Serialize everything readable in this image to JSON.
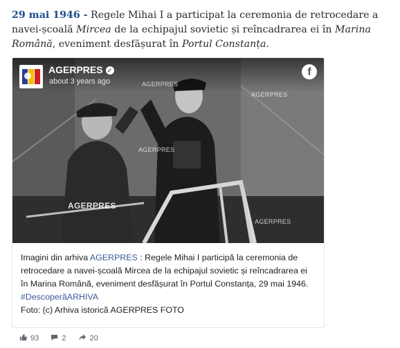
{
  "intro": {
    "date": "29 mai 1946 -",
    "part1": "Regele Mihai I a participat la ceremonia de retrocedare a navei-școală",
    "ship": "Mircea",
    "part2": "de la echipajul sovietic și reîncadrarea ei în",
    "navy": "Marina Română",
    "part3": ", eveniment desfășurat în",
    "port": "Portul Constanța",
    "end": "."
  },
  "post": {
    "page_name": "AGERPRES",
    "time": "about 3 years ago",
    "watermark": "AGERPRES",
    "caption_prefix": "Imagini din arhiva",
    "caption_link": "AGERPRES",
    "caption_body": ": Regele Mihai I participă la ceremonia de retrocedare a navei-școală Mircea de la echipajul sovietic și reîncadrarea ei în Marina Română, eveniment desfășurat în Portul Constanța, 29 mai 1946.",
    "hashtag": "#DescoperăARHIVA",
    "credit": "Foto: (c) Arhiva istorică AGERPRES FOTO"
  },
  "stats": {
    "likes": "93",
    "comments": "2",
    "shares": "20"
  },
  "icons": {
    "verified": "verified-badge-icon",
    "facebook": "facebook-icon",
    "like": "thumbs-up-icon",
    "comment": "comment-icon",
    "share": "share-icon"
  },
  "colors": {
    "date": "#1f4e8c",
    "link": "#3b5998"
  }
}
